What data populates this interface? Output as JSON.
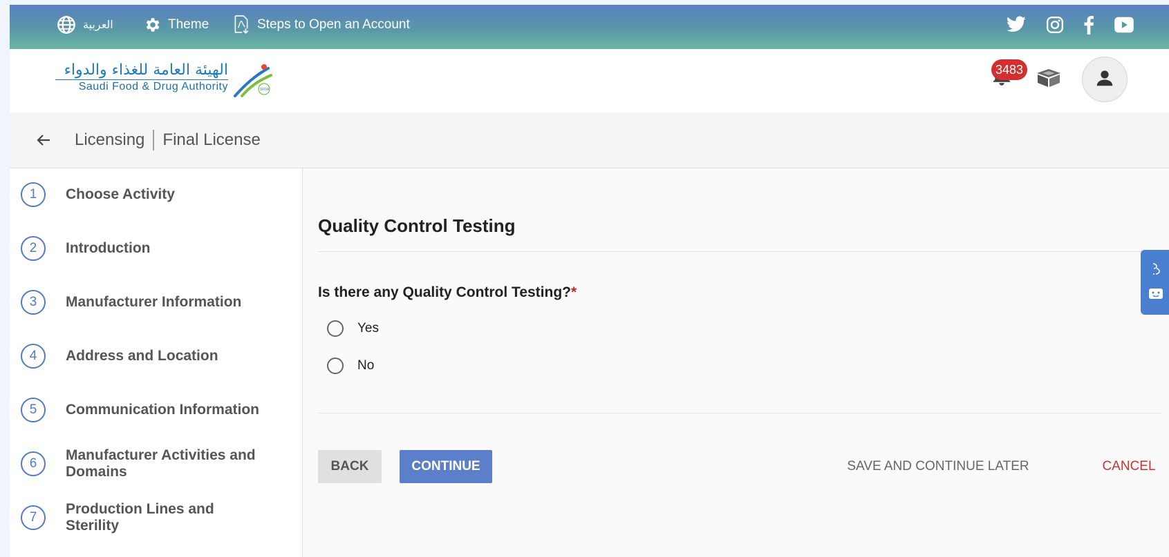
{
  "topbar": {
    "language_label": "العربية",
    "theme_label": "Theme",
    "steps_label": "Steps to Open an Account",
    "social_icons": [
      "twitter-icon",
      "instagram-icon",
      "facebook-icon",
      "youtube-icon"
    ]
  },
  "header": {
    "logo_ar": "الهيئة العامة للغذاء والدواء",
    "logo_en": "Saudi Food & Drug Authority",
    "logo_mark_text": "SFDA",
    "notification_count": "3483"
  },
  "breadcrumb": {
    "section": "Licensing",
    "page": "Final License"
  },
  "steps": [
    {
      "number": "1",
      "label": "Choose Activity"
    },
    {
      "number": "2",
      "label": "Introduction"
    },
    {
      "number": "3",
      "label": "Manufacturer Information"
    },
    {
      "number": "4",
      "label": "Address and Location"
    },
    {
      "number": "5",
      "label": "Communication Information"
    },
    {
      "number": "6",
      "label": "Manufacturer Activities and Domains"
    },
    {
      "number": "7",
      "label": "Production Lines and Sterility"
    }
  ],
  "main": {
    "title": "Quality Control Testing",
    "question": "Is there any Quality Control Testing?",
    "required_mark": "*",
    "options": [
      {
        "label": "Yes",
        "selected": false
      },
      {
        "label": "No",
        "selected": false
      }
    ],
    "buttons": {
      "back": "BACK",
      "continue": "CONTINUE",
      "save_later": "SAVE AND CONTINUE LATER",
      "cancel": "CANCEL"
    }
  },
  "colors": {
    "primary": "#5b7fc9",
    "step_accent": "#4f7bc8",
    "danger": "#d32f2f",
    "badge": "#d32f2f"
  }
}
